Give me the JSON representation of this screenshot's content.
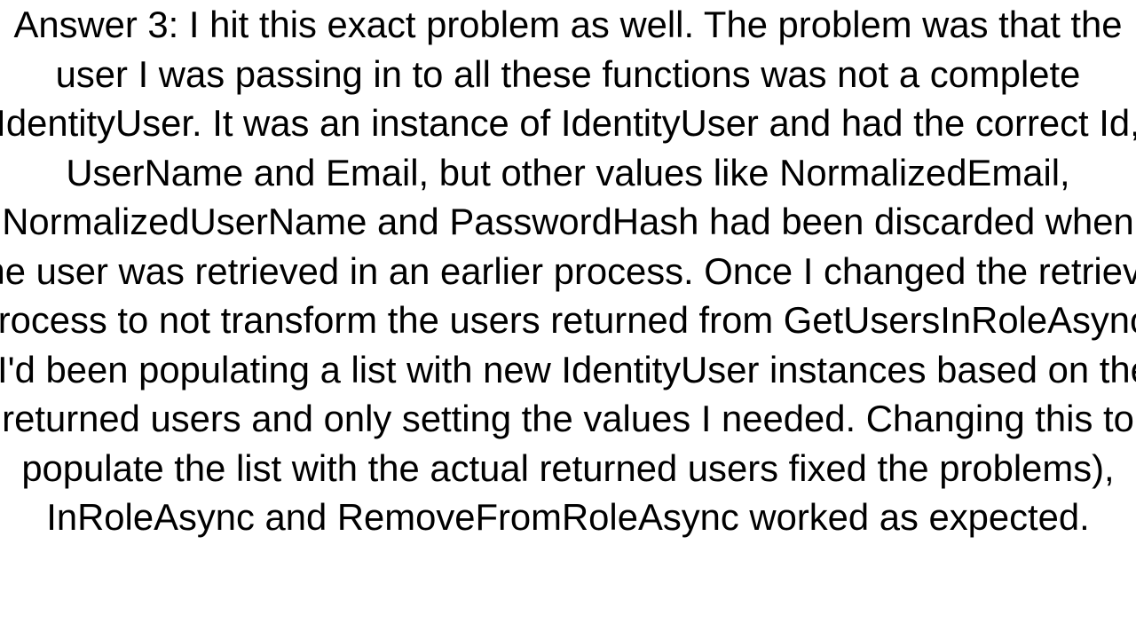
{
  "answer": {
    "label_prefix": "Answer 3:",
    "body": "I hit this exact problem as well. The problem was that the user I was passing in to all these functions was not a complete IdentityUser. It was an instance of IdentityUser and had the correct Id, UserName and Email, but other values like NormalizedEmail, NormalizedUserName and PasswordHash had been discarded when the user was retrieved in an earlier process. Once I changed the retrieve process to not transform the users returned from GetUsersInRoleAsync, (I'd been populating a list with new IdentityUser instances based on the returned users and only setting the values I needed. Changing this to populate the list with the actual returned users fixed the problems), InRoleAsync and RemoveFromRoleAsync worked as expected."
  }
}
